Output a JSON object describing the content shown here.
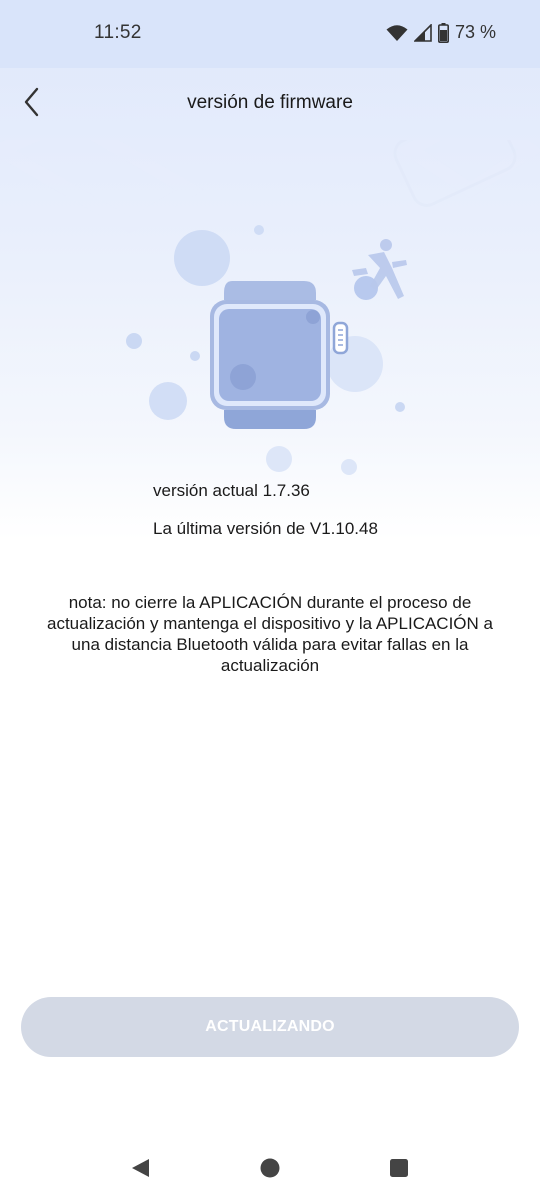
{
  "status_bar": {
    "time": "11:52",
    "battery_percent": "73 %",
    "icons": [
      "wifi-icon",
      "cell-signal-icon",
      "battery-icon"
    ]
  },
  "header": {
    "title": "versión de firmware",
    "back_icon": "chevron-left-icon"
  },
  "firmware": {
    "current_version": "versión actual 1.7.36",
    "latest_version": "La última versión de V1.10.48",
    "note": "nota: no cierre la APLICACIÓN durante el proceso de actualización y mantenga el dispositivo y la APLICACIÓN a una distancia Bluetooth válida para evitar fallas en la actualización"
  },
  "action": {
    "button_label": "ACTUALIZANDO",
    "enabled": false
  },
  "nav_bar": {
    "icons": [
      "back-triangle-icon",
      "home-circle-icon",
      "recents-square-icon"
    ]
  },
  "colors": {
    "hero_gradient_top": "#dfe8fb",
    "watch_blue": "#8fa6d8",
    "button_disabled": "#d3d9e5"
  }
}
